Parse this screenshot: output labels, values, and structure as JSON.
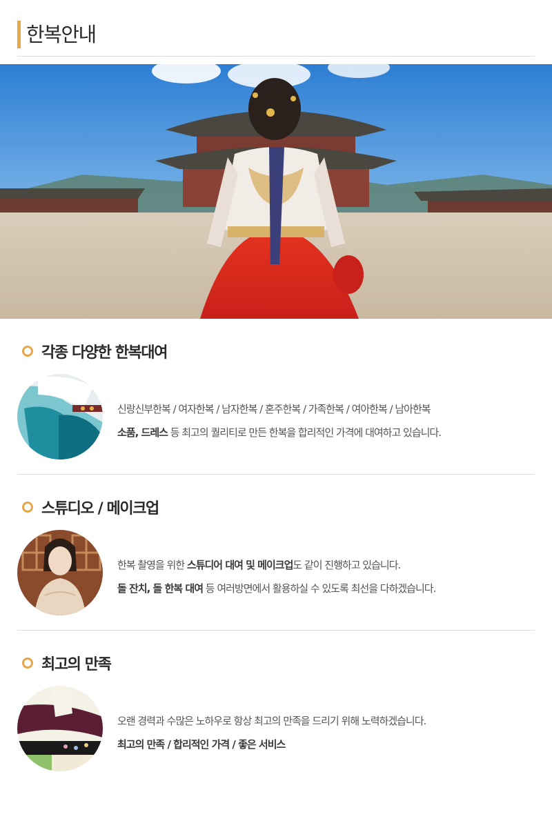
{
  "header": {
    "title": "한복안내"
  },
  "hero": {
    "alt": "hanbok-woman-at-palace"
  },
  "sections": [
    {
      "title": "각종 다양한 한복대여",
      "lines": [
        [
          {
            "t": "신랑신부한복 / 여자한복 / 남자한복 / 혼주한복 / 가족한복 / 여아한복 / 남아한복",
            "b": false
          }
        ],
        [
          {
            "t": "소품, 드레스",
            "b": true
          },
          {
            "t": " 등 최고의 퀄리티로 만든 한복을 합리적인 가격에 대여하고 있습니다.",
            "b": false
          }
        ]
      ]
    },
    {
      "title": "스튜디오 / 메이크업",
      "lines": [
        [
          {
            "t": "한복 촬영을 위한 ",
            "b": false
          },
          {
            "t": "스튜디어 대여 및 메이크업",
            "b": true
          },
          {
            "t": "도 같이 진행하고 있습니다.",
            "b": false
          }
        ],
        [
          {
            "t": "돌 잔치, 돌 한복 대여",
            "b": true
          },
          {
            "t": " 등 여러방면에서 활용하실 수 있도록 최선을 다하겠습니다.",
            "b": false
          }
        ]
      ]
    },
    {
      "title": "최고의 만족",
      "lines": [
        [
          {
            "t": "오랜 경력과 수많은 노하우로 항상 최고의 만족을 드리기 위해 노력하겠습니다.",
            "b": false
          }
        ],
        [
          {
            "t": "최고의 만족 / 합리적인 가격 / 좋은 서비스",
            "b": true
          }
        ]
      ]
    }
  ],
  "colors": {
    "accent": "#e8a64a",
    "divider": "#dcdcdc"
  }
}
